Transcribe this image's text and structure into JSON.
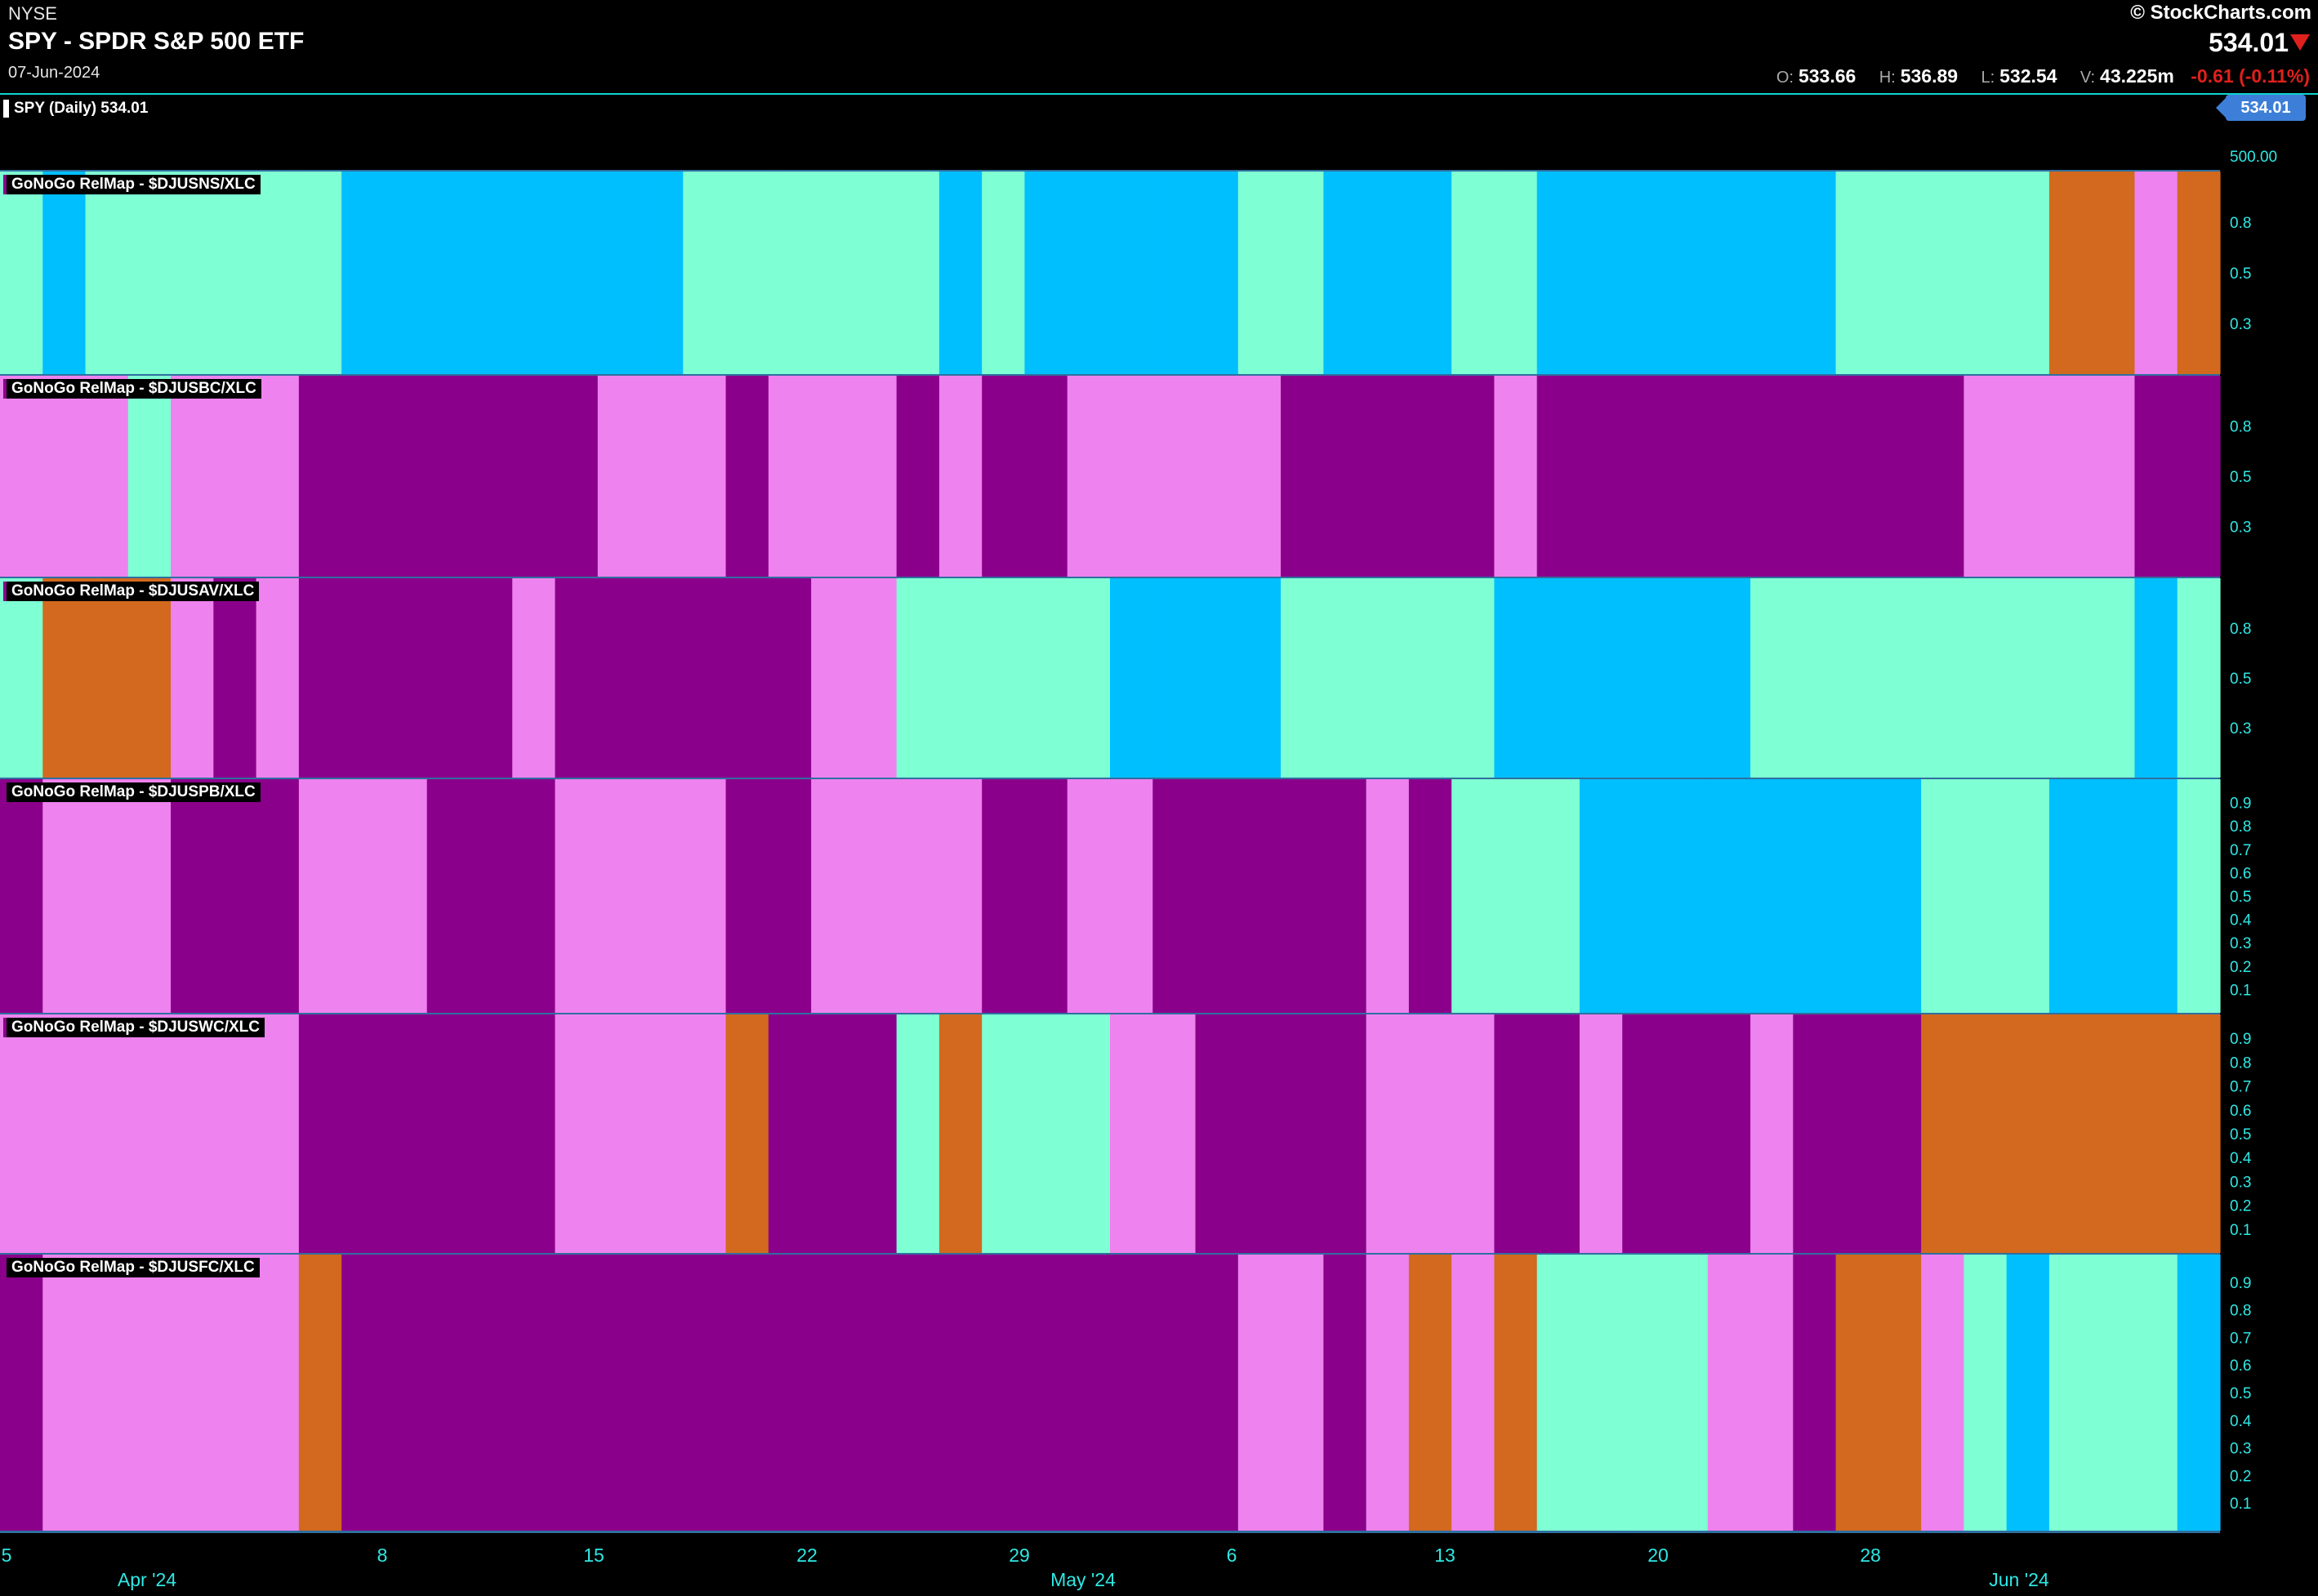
{
  "header": {
    "exchange": "NYSE",
    "title": "SPY - SPDR S&P 500 ETF",
    "date": "07-Jun-2024",
    "brand": "© StockCharts.com",
    "last_price": "534.01",
    "open_label": "O:",
    "open": "533.66",
    "high_label": "H:",
    "high": "536.89",
    "low_label": "L:",
    "low": "532.54",
    "volume_label": "V:",
    "volume": "43.225m",
    "change": "-0.61 (-0.11%)",
    "price_legend": "SPY (Daily) 534.01",
    "price_badge": "534.01",
    "price_axis_tick": "500.00"
  },
  "colors": {
    "bright_green": "#7fffd4",
    "blue": "#00bfff",
    "pink": "#ee82ee",
    "purple": "#8b008b",
    "amber": "#d2691e",
    "axis_text": "#2ee8e4",
    "separator": "#2f6f9f"
  },
  "chart_data": {
    "type": "heatmap",
    "x_tick_labels": [
      "5",
      "8",
      "15",
      "22",
      "29",
      "6",
      "13",
      "20",
      "28"
    ],
    "x_month_labels": [
      "Apr '24",
      "May '24",
      "Jun '24"
    ],
    "bar_count": 52,
    "legend": {
      "G": "bright green",
      "B": "blue",
      "P": "pink",
      "U": "purple",
      "A": "amber"
    },
    "panels": [
      {
        "label": "GoNoGo RelMap - $DJUSNS/XLC",
        "y_ticks": [
          "0.8",
          "0.5",
          "0.3"
        ],
        "colors": "GBGGGGGGBBBBBBBBGGGGGGBGBBBBBGGBBBGGBBBBBBBGGGGGAAPAAA"
      },
      {
        "label": "GoNoGo RelMap - $DJUSBC/XLC",
        "y_ticks": [
          "0.8",
          "0.5",
          "0.3"
        ],
        "colors": "PPPGPPPUUUUUUUPPPUPPPUPUUPPPPPUUUUUPUUUUUUUUUUPPPPUUU"
      },
      {
        "label": "GoNoGo RelMap - $DJUSAV/XLC",
        "y_ticks": [
          "0.8",
          "0.5",
          "0.3"
        ],
        "colors": "GAAAPUPUUUUUPUUUUUUPPGGGGGBBBBGGGGGBBBBBBGGGGGGGGGBG"
      },
      {
        "label": "GoNoGo RelMap - $DJUSPB/XLC",
        "y_ticks": [
          "0.9",
          "0.8",
          "0.7",
          "0.6",
          "0.5",
          "0.4",
          "0.3",
          "0.2",
          "0.1"
        ],
        "colors": "UPPPUUUPPPUUUPPPPUUPPPPUUPPUUUUUPUGGGBBBBBBBBGGGBBBGGGG"
      },
      {
        "label": "GoNoGo RelMap - $DJUSWC/XLC",
        "y_ticks": [
          "0.9",
          "0.8",
          "0.7",
          "0.6",
          "0.5",
          "0.4",
          "0.3",
          "0.2",
          "0.1"
        ],
        "colors": "PPPPPPPUUUUUUPPPPAUUUGAGGGPPUUUUPPPUUPUUUPUUUAAAAAAA"
      },
      {
        "label": "GoNoGo RelMap - $DJUSFC/XLC",
        "y_ticks": [
          "0.9",
          "0.8",
          "0.7",
          "0.6",
          "0.5",
          "0.4",
          "0.3",
          "0.2",
          "0.1"
        ],
        "colors": "UPPPPPPAUUUUUUUUUUUUUUUUUUUUUPPUPAPAGGGGPPUAAPGBGGGBAGBBAABBBBBBB"
      }
    ]
  }
}
